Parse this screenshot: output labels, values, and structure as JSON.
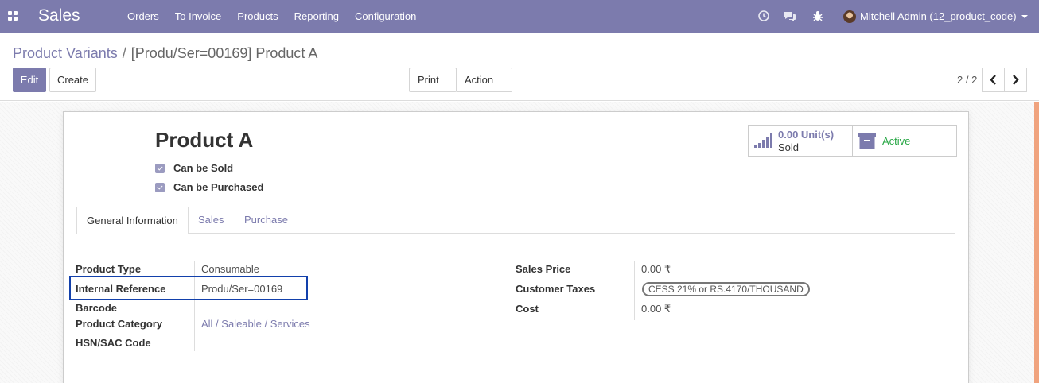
{
  "navbar": {
    "app_name": "Sales",
    "menu": [
      "Orders",
      "To Invoice",
      "Products",
      "Reporting",
      "Configuration"
    ],
    "user": "Mitchell Admin (12_product_code)"
  },
  "breadcrumb": {
    "parent": "Product Variants",
    "separator": "/",
    "current": "[Produ/Ser=00169] Product A"
  },
  "buttons": {
    "edit": "Edit",
    "create": "Create",
    "print": "Print",
    "action": "Action"
  },
  "pager": {
    "value": "2 / 2"
  },
  "product": {
    "name": "Product A",
    "can_be_sold": "Can be Sold",
    "can_be_purchased": "Can be Purchased"
  },
  "stats": {
    "sold_value": "0.00 Unit(s)",
    "sold_label": "Sold",
    "active_label": "Active"
  },
  "tabs": [
    "General Information",
    "Sales",
    "Purchase"
  ],
  "fields_left": [
    {
      "label": "Product Type",
      "value": "Consumable"
    },
    {
      "label": "Internal Reference",
      "value": "Produ/Ser=00169"
    },
    {
      "label": "Barcode",
      "value": ""
    },
    {
      "label": "Product Category",
      "value": "All / Saleable / Services"
    },
    {
      "label": "HSN/SAC Code",
      "value": ""
    }
  ],
  "fields_right": [
    {
      "label": "Sales Price",
      "value": "0.00 ₹"
    },
    {
      "label": "Customer Taxes",
      "value": "CESS 21% or RS.4170/THOUSAND"
    },
    {
      "label": "Cost",
      "value": "0.00 ₹"
    }
  ],
  "colors": {
    "brand": "#7c7bad",
    "active": "#28a745",
    "highlight": "#1240ab"
  },
  "icons": [
    "apps-grid-icon",
    "clock-icon",
    "chat-icon",
    "bug-icon",
    "bar-chart-icon",
    "archive-icon",
    "chevron-left-icon",
    "chevron-right-icon"
  ]
}
